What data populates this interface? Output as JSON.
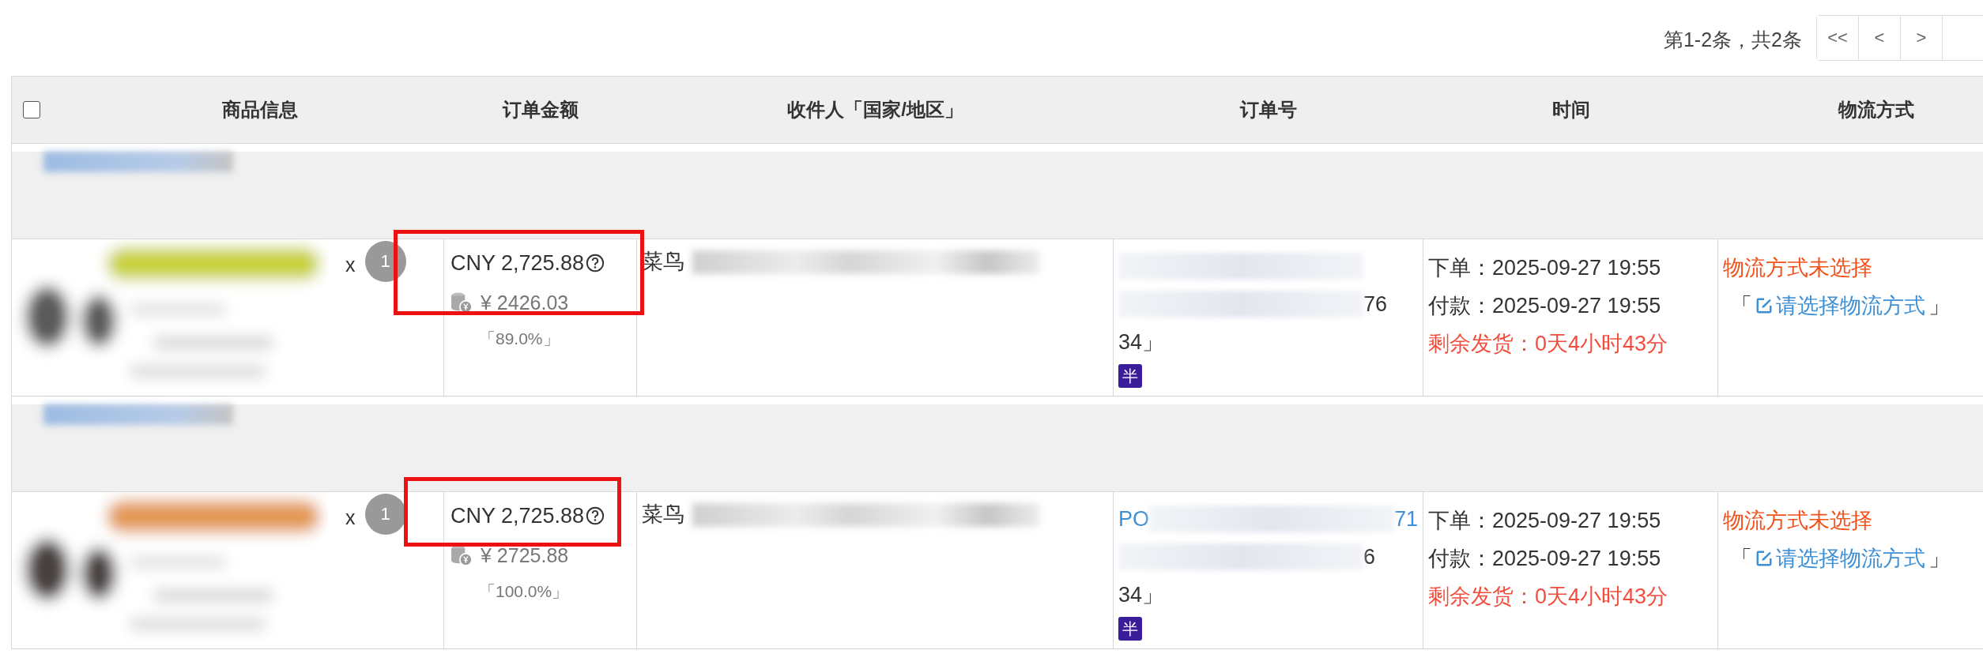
{
  "pagination": {
    "summary": "第1-2条，共2条",
    "buttons": [
      "<<",
      "<",
      ">"
    ]
  },
  "table": {
    "select_all": {
      "checked": false
    },
    "columns": [
      "商品信息",
      "订单金额",
      "收件人「国家/地区」",
      "订单号",
      "时间",
      "物流方式"
    ],
    "rows": [
      {
        "quantity_prefix": "x",
        "quantity": "1",
        "amount": "CNY 2,725.88",
        "paid": "¥ 2426.03",
        "ratio": "「89.0%」",
        "highlighted": true,
        "recipient": "菜鸟",
        "order_lines": [
          {
            "kind": "link",
            "segments": [
              {
                "kind": "blurred"
              }
            ]
          },
          {
            "kind": "plain",
            "segments": [
              {
                "kind": "blurred"
              },
              {
                "kind": "text",
                "text": "76"
              }
            ]
          },
          {
            "kind": "plain",
            "segments": [
              {
                "kind": "text",
                "text": "34」"
              }
            ]
          }
        ],
        "tag": "半",
        "order_time": "下单：2025-09-27 19:55",
        "pay_time": "付款：2025-09-27 19:55",
        "remaining": "剩余发货：0天4小时43分",
        "shipping_status": "物流方式未选择",
        "action_open": "「",
        "action": "请选择物流方式",
        "action_close": "」"
      },
      {
        "quantity_prefix": "x",
        "quantity": "1",
        "amount": "CNY 2,725.88",
        "paid": "¥ 2725.88",
        "ratio": "「100.0%」",
        "highlighted": true,
        "recipient": "菜鸟",
        "order_lines": [
          {
            "kind": "link",
            "segments": [
              {
                "kind": "text",
                "text": "PO"
              },
              {
                "kind": "blurred"
              },
              {
                "kind": "text",
                "text": "71"
              }
            ]
          },
          {
            "kind": "plain",
            "segments": [
              {
                "kind": "blurred"
              },
              {
                "kind": "text",
                "text": "6"
              }
            ]
          },
          {
            "kind": "plain",
            "segments": [
              {
                "kind": "text",
                "text": "34」"
              }
            ]
          }
        ],
        "tag": "半",
        "order_time": "下单：2025-09-27 19:55",
        "pay_time": "付款：2025-09-27 19:55",
        "remaining": "剩余发货：0天4小时43分",
        "shipping_status": "物流方式未选择",
        "action_open": "「",
        "action": "请选择物流方式",
        "action_close": "」"
      }
    ]
  }
}
